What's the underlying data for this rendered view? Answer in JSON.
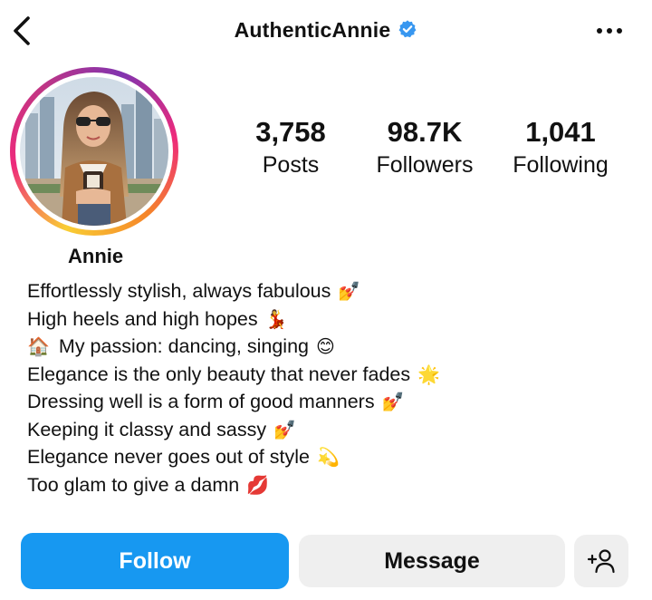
{
  "header": {
    "back_icon": "chevron-left-icon",
    "username": "AuthenticAnnie",
    "verified_icon": "verified-badge-icon",
    "more_icon": "more-horizontal-icon"
  },
  "profile": {
    "display_name": "Annie",
    "avatar": "profile-photo"
  },
  "stats": [
    {
      "value": "3,758",
      "label": "Posts"
    },
    {
      "value": "98.7K",
      "label": "Followers"
    },
    {
      "value": "1,041",
      "label": "Following"
    }
  ],
  "bio": [
    {
      "text": "Effortlessly stylish, always fabulous",
      "emoji": "💅"
    },
    {
      "text": "High heels and high hopes",
      "emoji": "💃"
    },
    {
      "lead_emoji": "🏠",
      "text": "My passion: dancing, singing",
      "emoji": "😊"
    },
    {
      "text": "Elegance is the only beauty that never fades",
      "emoji": "🌟"
    },
    {
      "text": "Dressing well is a form of good manners",
      "emoji": "💅"
    },
    {
      "text": "Keeping it classy and sassy",
      "emoji": "💅"
    },
    {
      "text": "Elegance never goes out of style",
      "emoji": "💫"
    },
    {
      "text": "Too glam to give a damn",
      "emoji": "💋"
    }
  ],
  "actions": {
    "follow_label": "Follow",
    "message_label": "Message",
    "add_user_icon": "add-person-icon"
  },
  "colors": {
    "follow_button": "#1798f1",
    "secondary_button": "#efefef",
    "verified_badge": "#3897f0"
  }
}
